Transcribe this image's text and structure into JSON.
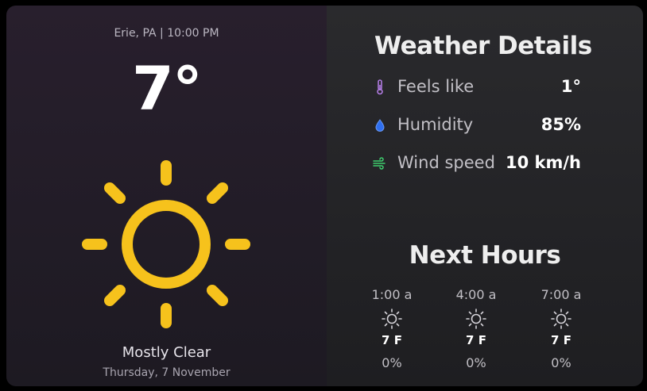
{
  "current": {
    "location_time": "Erie, PA | 10:00 PM",
    "temperature": "7°",
    "condition": "Mostly Clear",
    "date": "Thursday, 7 November",
    "icon": "sun-icon"
  },
  "details": {
    "title": "Weather Details",
    "items": [
      {
        "label": "Feels like",
        "value": "1°",
        "icon": "thermometer-icon",
        "color": "#b07be0"
      },
      {
        "label": "Humidity",
        "value": "85%",
        "icon": "water-drop-icon",
        "color": "#2f6ff0"
      },
      {
        "label": "Wind speed",
        "value": "10 km/h",
        "icon": "wind-icon",
        "color": "#3ecf6e"
      }
    ]
  },
  "forecast": {
    "title": "Next Hours",
    "hours": [
      {
        "time": "1:00 a",
        "temp": "7 F",
        "precip": "0%",
        "icon": "sun-icon"
      },
      {
        "time": "4:00 a",
        "temp": "7 F",
        "precip": "0%",
        "icon": "sun-icon"
      },
      {
        "time": "7:00 a",
        "temp": "7 F",
        "precip": "0%",
        "icon": "sun-icon"
      }
    ]
  },
  "colors": {
    "sun": "#f6c21c",
    "left_panel": "#251d2a",
    "right_panel": "#252528"
  }
}
